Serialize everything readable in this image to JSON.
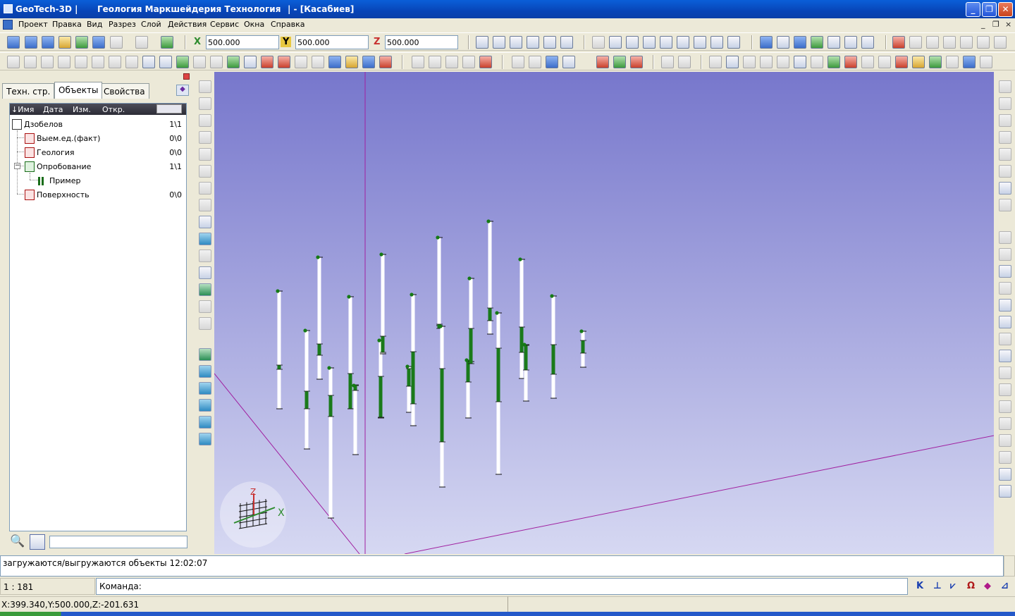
{
  "window": {
    "app_name": "GeoTech-3D |",
    "subtitle": "Геология Маркшейдерия Технология",
    "document": "| - [Касабиев]",
    "minimize": "_",
    "maximize": "❐",
    "close": "✕"
  },
  "menu": [
    "Проект",
    "Правка",
    "Вид",
    "Разрез",
    "Слой",
    "Действия",
    "Сервис",
    "Окна",
    "Справка"
  ],
  "mdi_controls": [
    "_",
    "❐",
    "×"
  ],
  "coordinates_toolbar": {
    "x_label": "X",
    "x_value": "500.000",
    "y_label": "Y",
    "y_value": "500.000",
    "z_label": "Z",
    "z_value": "500.000"
  },
  "panel_tabs": [
    "Техн. стр.",
    "Объекты",
    "Свойства"
  ],
  "tree": {
    "columns": [
      "↓Имя",
      "Дата",
      "Изм.",
      "Откр."
    ],
    "items": [
      {
        "label": "Дзобелов",
        "count": "1\\1"
      },
      {
        "label": "Выем.ед.(факт)",
        "count": "0\\0"
      },
      {
        "label": "Геология",
        "count": "0\\0"
      },
      {
        "label": "Опробование",
        "count": "1\\1"
      },
      {
        "label": "Пример",
        "count": ""
      },
      {
        "label": "Поверхность",
        "count": "0\\0"
      }
    ]
  },
  "viewport": {
    "axis_x_label": "X",
    "axis_z_label": "Z",
    "colors": {
      "sky_top": "#7777cc",
      "sky_bottom": "#d6d8f2",
      "axis_line": "#a020a0",
      "hole": "#ffffff",
      "sample": "#1a7a1a",
      "collar": "#157a15"
    }
  },
  "status": {
    "message": "загружаются/выгружаются объекты 12:02:07",
    "scale": "1 : 181",
    "command_label": "Команда:",
    "coords": "X:399.340,Y:500.000,Z:-201.631",
    "snap_glyphs": [
      "K",
      "⊥",
      "⩗",
      "Ω",
      "◆",
      "⊿"
    ]
  }
}
